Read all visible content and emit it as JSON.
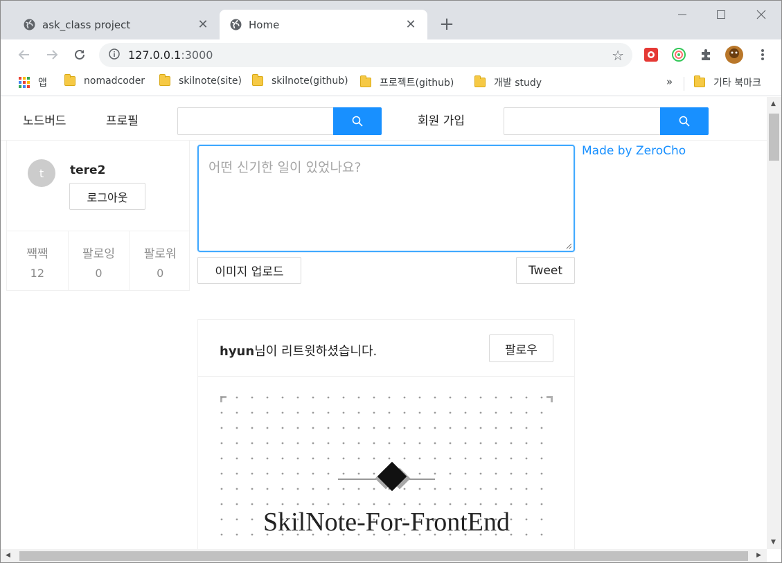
{
  "browser": {
    "tabs": [
      {
        "title": "ask_class project",
        "active": false,
        "icon": "globe-icon"
      },
      {
        "title": "Home",
        "active": true,
        "icon": "globe-icon"
      }
    ],
    "new_tab_label": "+",
    "url_host": "127.0.0.1",
    "url_port": ":3000",
    "bookmarks": [
      {
        "label": "앱",
        "icon": "apps-grid-icon"
      },
      {
        "label": "nomadcoder",
        "icon": "folder-icon"
      },
      {
        "label": "skilnote(site)",
        "icon": "folder-icon"
      },
      {
        "label": "skilnote(github)",
        "icon": "folder-icon"
      },
      {
        "label": "프로젝트(github)",
        "icon": "folder-icon"
      },
      {
        "label": "개발 study",
        "icon": "folder-icon"
      }
    ],
    "bookmarks_overflow": "»",
    "other_bookmarks": "기타 북마크"
  },
  "nav": {
    "items": [
      "노드버드",
      "프로필"
    ],
    "signup": "회원 가입"
  },
  "profile": {
    "avatar_letter": "t",
    "nickname": "tere2",
    "logout_label": "로그아웃",
    "stats": [
      {
        "label": "짹짹",
        "value": "12"
      },
      {
        "label": "팔로잉",
        "value": "0"
      },
      {
        "label": "팔로워",
        "value": "0"
      }
    ]
  },
  "post_form": {
    "placeholder": "어떤 신기한 일이 있었나요?",
    "upload_label": "이미지 업로드",
    "tweet_label": "Tweet"
  },
  "credit": "Made by ZeroCho",
  "post": {
    "user": "hyun",
    "retweet_suffix": "님이 리트윗하셨습니다.",
    "follow_label": "팔로우",
    "image_title": "SkilNote-For-FrontEnd"
  },
  "colors": {
    "primary": "#1890ff",
    "focus_border": "#40a9ff",
    "tabstrip": "#dee1e6"
  }
}
